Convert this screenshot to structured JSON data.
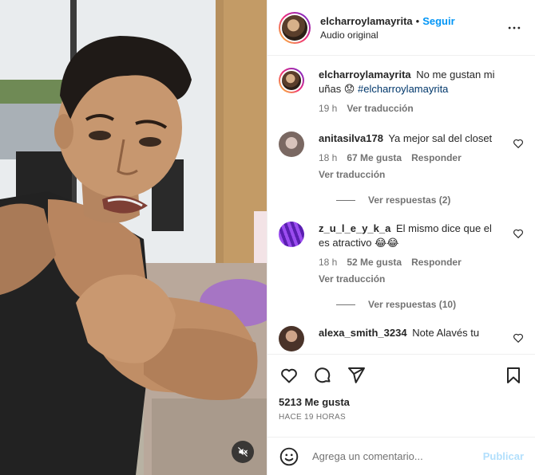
{
  "post": {
    "username": "elcharroylamayrita",
    "separator": "•",
    "follow_label": "Seguir",
    "audio": "Audio original",
    "more_icon": "more-horizontal-icon"
  },
  "caption": {
    "username": "elcharroylamayrita",
    "text": "No me gustan mi uñas 😟",
    "hashtag": "#elcharroylamayrita",
    "time": "19 h",
    "translate": "Ver traducción"
  },
  "comments": [
    {
      "username": "anitasilva178",
      "text": "Ya mejor sal del closet",
      "time": "18 h",
      "likes": "67 Me gusta",
      "reply": "Responder",
      "translate": "Ver traducción",
      "replies": "Ver respuestas (2)",
      "avatar_color": "#9a8a84"
    },
    {
      "username": "z_u_l_e_y_k_a",
      "text": "El mismo dice que el es atractivo 😂😂",
      "time": "18 h",
      "likes": "52 Me gusta",
      "reply": "Responder",
      "translate": "Ver traducción",
      "replies": "Ver respuestas (10)",
      "avatar_color": "#7b2fd0"
    },
    {
      "username": "alexa_smith_3234",
      "text": "Note Alavés tu",
      "avatar_color": "#5b4235"
    }
  ],
  "actions": {
    "like_icon": "heart-icon",
    "comment_icon": "comment-icon",
    "share_icon": "send-icon",
    "save_icon": "bookmark-icon",
    "likes": "5213 Me gusta",
    "time": "HACE 19 HORAS"
  },
  "composer": {
    "placeholder": "Agrega un comentario...",
    "publish_label": "Publicar",
    "emoji_icon": "emoji-icon"
  },
  "media": {
    "mute_icon": "muted-speaker-icon"
  },
  "colors": {
    "accent": "#0095f6",
    "publish_disabled": "#b2dffc",
    "muted_text": "#737373",
    "hashtag": "#00376b"
  }
}
